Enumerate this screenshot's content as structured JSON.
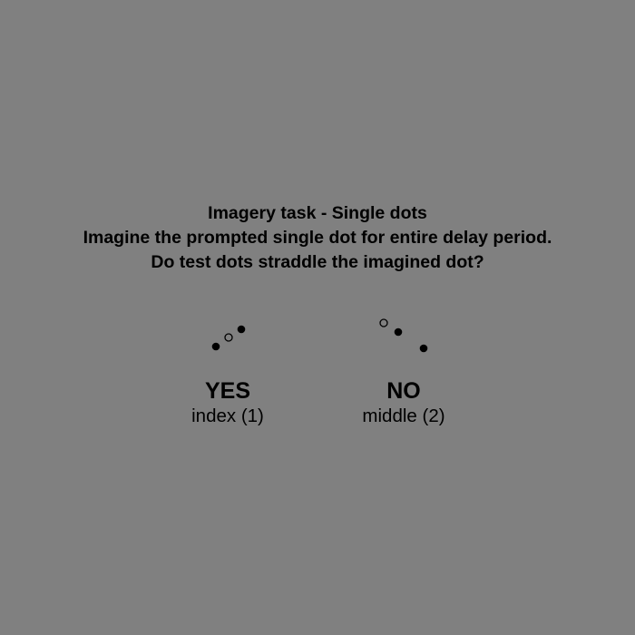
{
  "instructions": {
    "title": "Imagery task - Single dots",
    "line1": "Imagine the prompted single dot for entire delay period.",
    "line2": "Do test dots straddle the imagined dot?"
  },
  "options": [
    {
      "label": "YES",
      "key": "index (1)"
    },
    {
      "label": "NO",
      "key": "middle (2)"
    }
  ]
}
